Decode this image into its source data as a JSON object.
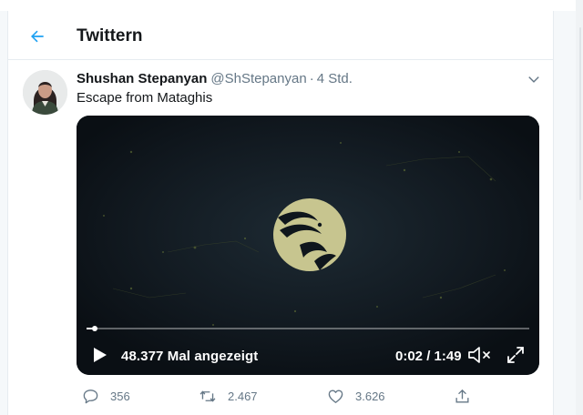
{
  "header": {
    "title": "Twittern",
    "back_icon": "arrow-left-icon",
    "accent_color": "#1da1f2"
  },
  "tweet": {
    "display_name": "Shushan Stepanyan",
    "handle": "@ShStepanyan",
    "separator": "·",
    "time": "4 Std.",
    "text": "Escape from Mataghis",
    "more_icon": "chevron-down-icon",
    "video": {
      "view_count": "48.377 Mal angezeigt",
      "time_display": "0:02 / 1:49",
      "progress_fraction": 0.018,
      "play_icon": "play-icon",
      "mute_icon": "muted-speaker-icon",
      "fullscreen_icon": "fullscreen-icon"
    },
    "actions": {
      "reply_count": "356",
      "retweet_count": "2.467",
      "like_count": "3.626",
      "reply_icon": "reply-icon",
      "retweet_icon": "retweet-icon",
      "like_icon": "heart-icon",
      "share_icon": "share-icon"
    }
  }
}
